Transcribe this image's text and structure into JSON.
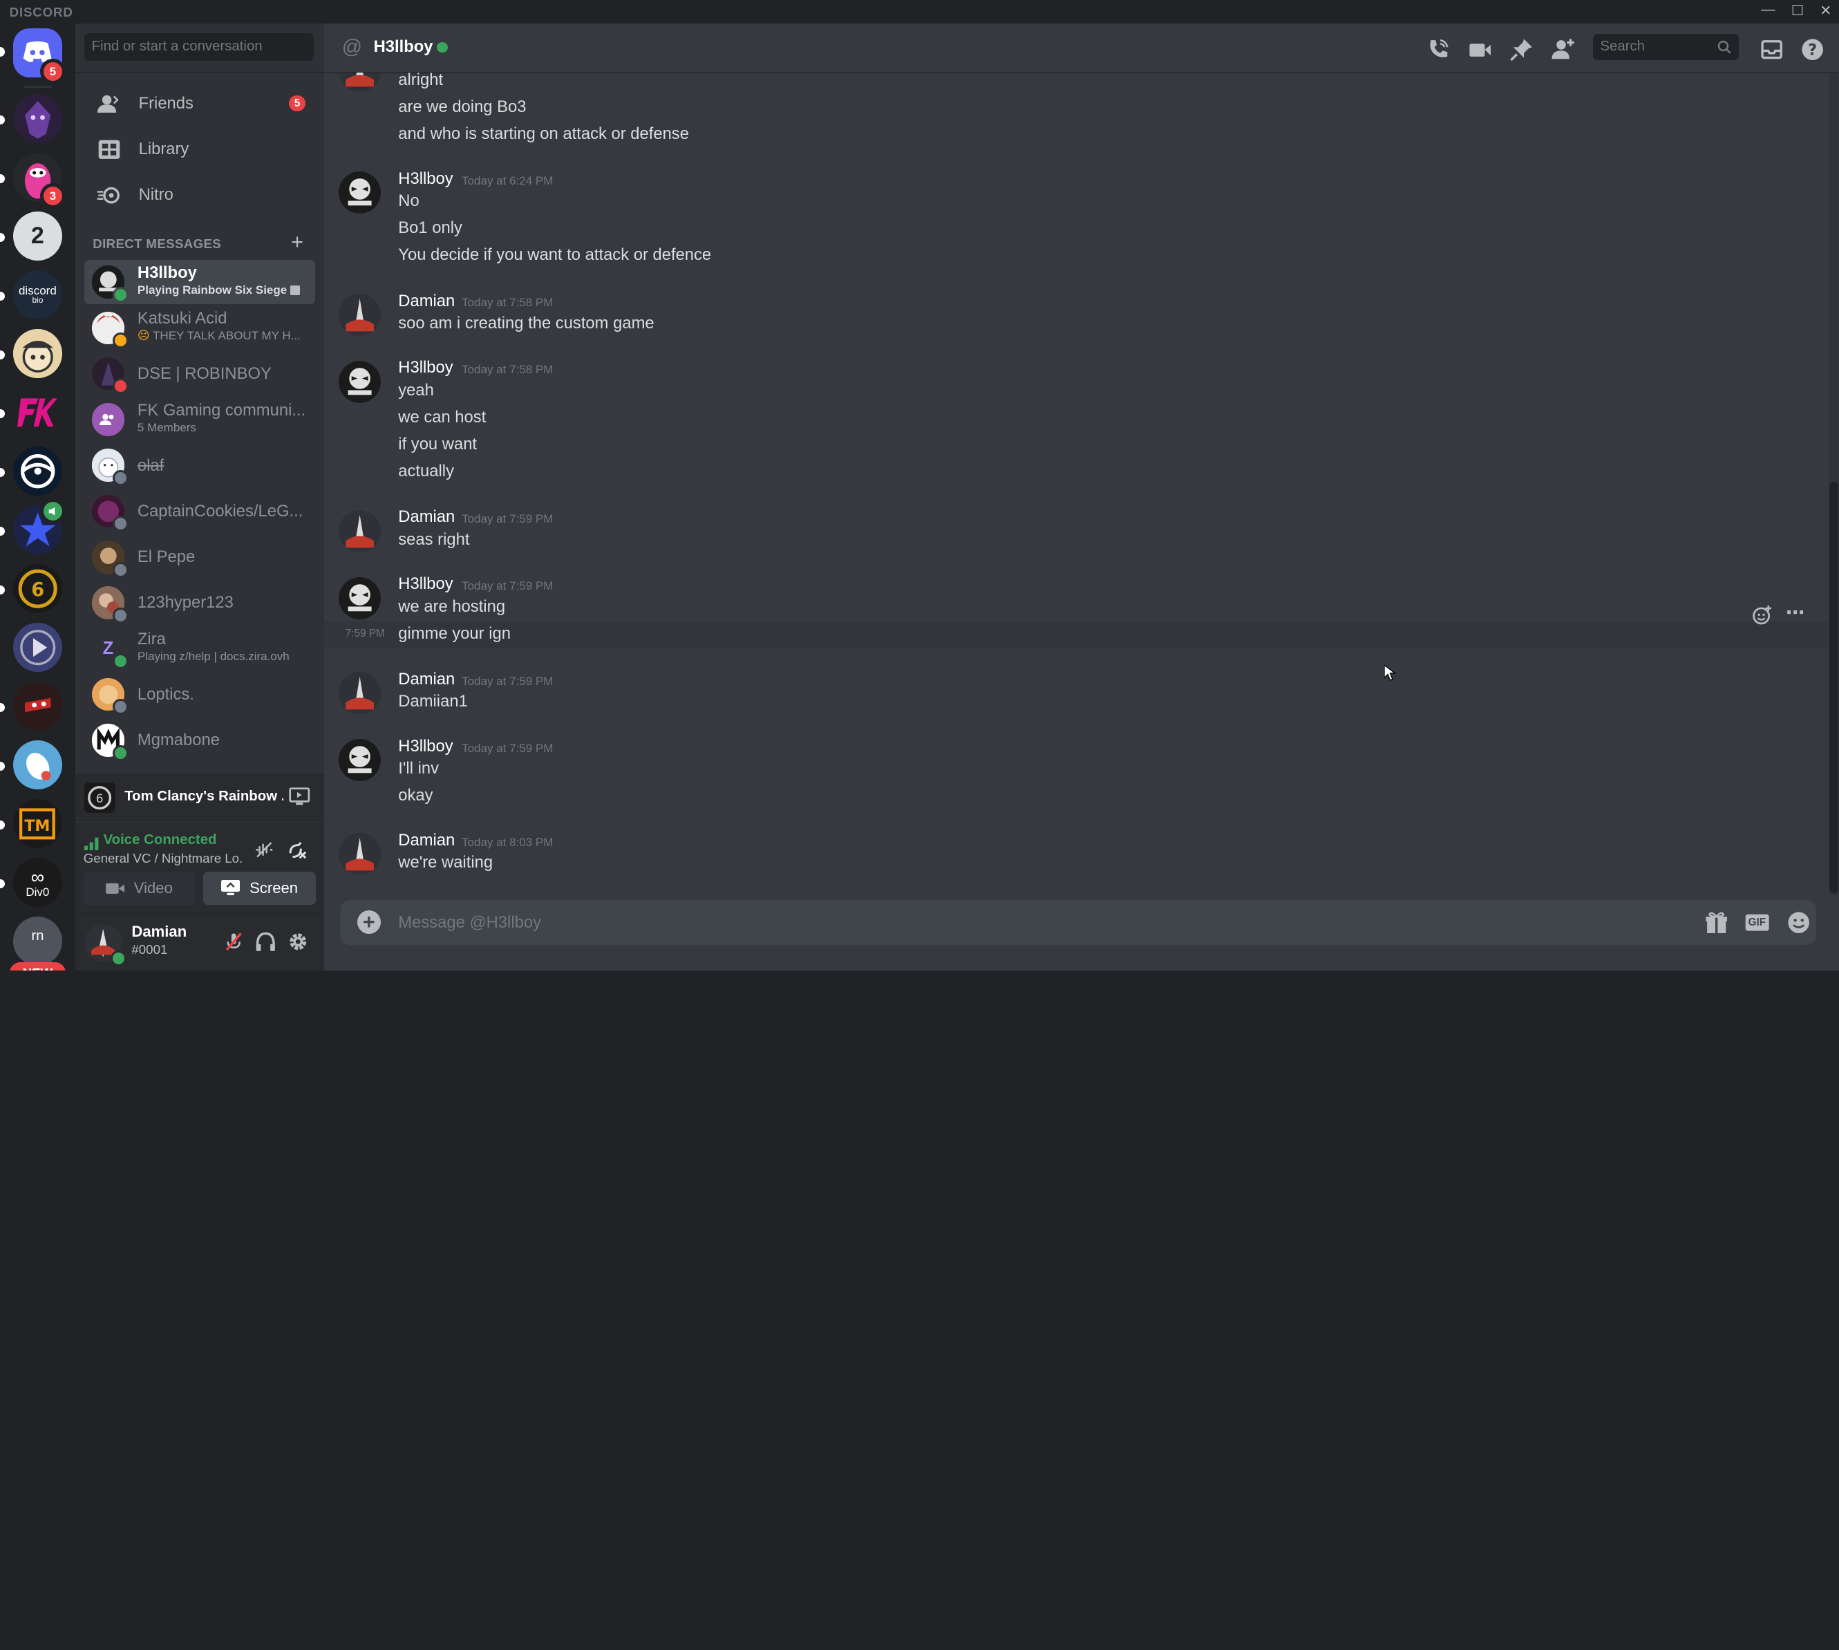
{
  "window": {
    "brand": "DISCORD",
    "controls": [
      "—",
      "☐",
      "✕"
    ]
  },
  "guilds": {
    "home_badge": "5",
    "fall_guys_badge": "3",
    "destiny_label": "2",
    "discordbio_label": "discord",
    "discordbio_sub": "bio",
    "rn_label": "rn",
    "divo_label": "Div0",
    "new_badge": "NEW"
  },
  "sidebar": {
    "search_placeholder": "Find or start a conversation",
    "nav": [
      {
        "label": "Friends",
        "badge": "5"
      },
      {
        "label": "Library"
      },
      {
        "label": "Nitro"
      }
    ],
    "dm_header": "DIRECT MESSAGES",
    "dms": [
      {
        "name": "H3llboy",
        "sub": "Playing Rainbow Six Siege",
        "status_color": "#3ba55d"
      },
      {
        "name": "Katsuki Acid",
        "sub": "THEY TALK ABOUT MY H...",
        "status_color": "#faa81a"
      },
      {
        "name": "DSE | ROBINBOY",
        "status_color": "#ed4245"
      },
      {
        "name": "FK Gaming communi...",
        "sub": "5 Members"
      },
      {
        "name": "olaf",
        "status_color": "#747f8d"
      },
      {
        "name": "CaptainCookies/LeG...",
        "status_color": "#747f8d"
      },
      {
        "name": "El Pepe",
        "status_color": "#747f8d"
      },
      {
        "name": "123hyper123",
        "status_color": "#747f8d"
      },
      {
        "name": "Zira",
        "sub": "Playing z/help | docs.zira.ovh",
        "status_color": "#3ba55d"
      },
      {
        "name": "Loptics.",
        "status_color": "#747f8d"
      },
      {
        "name": "Mgmabone",
        "status_color": "#3ba55d"
      }
    ]
  },
  "activity": {
    "game": "Tom Clancy's Rainbow ..."
  },
  "voice": {
    "status": "Voice Connected",
    "channel": "General VC / Nightmare Lo...",
    "video_label": "Video",
    "screen_label": "Screen"
  },
  "user": {
    "name": "Damian",
    "tag": "#0001"
  },
  "header": {
    "title": "H3llboy",
    "search_placeholder": "Search"
  },
  "messages": {
    "continuation": [
      "alright",
      "are we doing Bo3",
      "and who is starting on attack or defense"
    ],
    "groups": [
      {
        "author": "H3llboy",
        "time": "Today at 6:24 PM",
        "lines": [
          "No",
          "Bo1 only",
          "You decide if you want to attack or defence"
        ]
      },
      {
        "author": "Damian",
        "time": "Today at 7:58 PM",
        "lines": [
          "soo am i creating the custom game"
        ]
      },
      {
        "author": "H3llboy",
        "time": "Today at 7:58 PM",
        "lines": [
          "yeah",
          "we can host",
          "if you want",
          "actually"
        ]
      },
      {
        "author": "Damian",
        "time": "Today at 7:59 PM",
        "lines": [
          "seas right"
        ]
      },
      {
        "author": "H3llboy",
        "time": "Today at 7:59 PM",
        "lines": [
          "we are hosting",
          "gimme your ign"
        ]
      },
      {
        "author": "Damian",
        "time": "Today at 7:59 PM",
        "lines": [
          "Damiian1"
        ]
      },
      {
        "author": "H3llboy",
        "time": "Today at 7:59 PM",
        "lines": [
          "I'll inv",
          "okay"
        ]
      },
      {
        "author": "Damian",
        "time": "Today at 8:03 PM",
        "lines": [
          "we're waiting"
        ]
      }
    ],
    "hover_time": "7:59 PM"
  },
  "composer": {
    "placeholder": "Message @H3llboy",
    "gif_label": "GIF"
  }
}
